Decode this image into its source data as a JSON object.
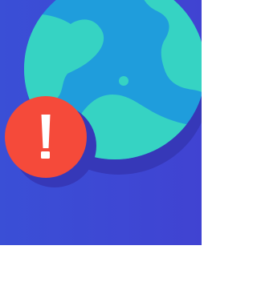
{
  "illustration": {
    "subject": "globe-icon",
    "badge_icon": "exclamation-icon",
    "colors": {
      "background_left": "#3a4fd6",
      "background_right": "#4043d2",
      "globe_shadow": "#3638b8",
      "ocean": "#1f9ddc",
      "land": "#36d3c3",
      "badge": "#f54a3a",
      "badge_mark": "#ffffff"
    }
  }
}
